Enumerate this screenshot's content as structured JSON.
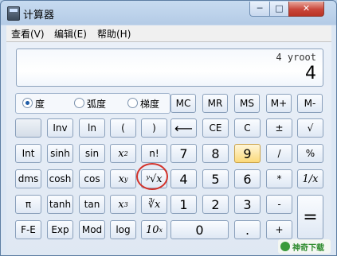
{
  "window": {
    "title": "计算器",
    "min_glyph": "─",
    "max_glyph": "□",
    "close_glyph": "✕"
  },
  "menu": [
    "查看(V)",
    "编辑(E)",
    "帮助(H)"
  ],
  "display": {
    "expression": "4 yroot",
    "result": "4"
  },
  "angle_modes": [
    {
      "label": "度",
      "selected": true
    },
    {
      "label": "弧度",
      "selected": false
    },
    {
      "label": "梯度",
      "selected": false
    }
  ],
  "memory": [
    "MC",
    "MR",
    "MS",
    "M+",
    "M-"
  ],
  "buttons": {
    "inv": "Inv",
    "ln": "ln",
    "lparen": "(",
    "rparen": ")",
    "back": "⟵",
    "ce": "CE",
    "c": "C",
    "pm": "±",
    "sqrt": "√",
    "int": "Int",
    "sinh": "sinh",
    "sin": "sin",
    "x2": "x",
    "x2sup": "2",
    "fact": "n!",
    "d7": "7",
    "d8": "8",
    "d9": "9",
    "div": "/",
    "pct": "%",
    "dms": "dms",
    "cosh": "cosh",
    "cos": "cos",
    "xy": "x",
    "xysup": "y",
    "yroot": "ʸ√x",
    "d4": "4",
    "d5": "5",
    "d6": "6",
    "mul": "*",
    "recip": "1/x",
    "pi": "π",
    "tanh": "tanh",
    "tan": "tan",
    "x3": "x",
    "x3sup": "3",
    "cbrt": "∛x",
    "d1": "1",
    "d2": "2",
    "d3": "3",
    "sub": "-",
    "eq": "=",
    "fe": "F-E",
    "exp": "Exp",
    "mod": "Mod",
    "log": "log",
    "tenx": "10",
    "tenxsup": "x",
    "d0": "0",
    "dot": ".",
    "add": "+"
  },
  "watermark": "神奇下载"
}
